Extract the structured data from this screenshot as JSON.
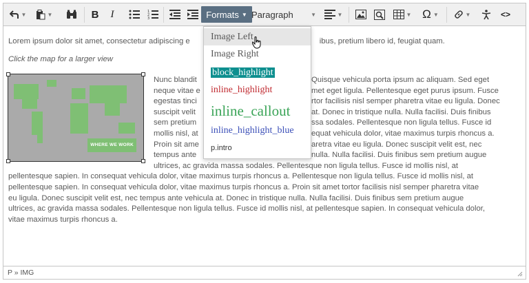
{
  "toolbar": {
    "formats_label": "Formats",
    "block_format_value": "Paragraph",
    "icons": [
      "undo-icon",
      "paste-icon",
      "find-icon",
      "bold-icon",
      "italic-icon",
      "bullet-list-icon",
      "numbered-list-icon",
      "outdent-icon",
      "indent-icon",
      "formats-dropdown",
      "align-icon",
      "image-icon",
      "media-icon",
      "table-icon",
      "special-char-icon",
      "link-icon",
      "accessibility-icon",
      "code-icon"
    ],
    "bold_glyph": "B",
    "italic_glyph": "I",
    "omega_glyph": "Ω",
    "code_glyph": "<>"
  },
  "content": {
    "paragraph1": "Lorem ipsum dolor sit amet, consectetur adipiscing e",
    "paragraph1_tail": "ibus, pretium libero id, feugiat quam.",
    "caption": "Click the map for a larger view",
    "map_tag": "WHERE WE WORK",
    "wrap_lines": [
      {
        "left": "Nunc blandit",
        "right": "Quisque vehicula porta ipsum ac aliquam. Sed eget"
      },
      {
        "left": "neque vitae e",
        "right": "met eget ligula. Pellentesque eget purus ipsum. Fusce"
      },
      {
        "left": "egestas tinci",
        "right": "rtor facilisis nisl semper pharetra vitae eu ligula. Donec"
      },
      {
        "left": "suscipit velit",
        "right": "at. Donec in tristique nulla. Nulla facilisi. Duis finibus"
      },
      {
        "left": "sem pretium",
        "right": "ssa sodales. Pellentesque non ligula tellus. Fusce id"
      },
      {
        "left": "mollis nisl, at",
        "right": "equat vehicula dolor, vitae maximus turpis rhoncus a."
      },
      {
        "left": "Proin sit ame",
        "right": "aretra vitae eu ligula. Donec suscipit velit est, nec"
      },
      {
        "left": "tempus ante",
        "right": "nulla. Nulla facilisi. Duis finibus sem pretium augue"
      }
    ],
    "after_image": "ultrices, ac gravida massa sodales. Pellentesque non ligula tellus. Fusce id mollis nisl, at",
    "full_lines": [
      "pellentesque sapien. In consequat vehicula dolor, vitae maximus turpis rhoncus a. Pellentesque non ligula tellus. Fusce id mollis nisl, at",
      "pellentesque sapien. In consequat vehicula dolor, vitae maximus turpis rhoncus a.  Proin sit amet tortor facilisis nisl semper pharetra vitae",
      "eu ligula. Donec suscipit velit est, nec tempus ante vehicula at. Donec in tristique nulla. Nulla facilisi. Duis finibus sem pretium augue",
      "ultrices, ac gravida massa sodales. Pellentesque non ligula tellus. Fusce id mollis nisl, at pellentesque sapien. In consequat vehicula dolor,",
      "vitae maximus turpis rhoncus a."
    ]
  },
  "dropdown": {
    "items": [
      {
        "label": "Image Left",
        "style": "plain",
        "color": "#595959"
      },
      {
        "label": "Image Right",
        "style": "plain",
        "color": "#595959"
      },
      {
        "label": "block_highlight",
        "style": "block",
        "color": "#ffffff",
        "background": "#0e8f8f"
      },
      {
        "label": "inline_highlight",
        "style": "inline",
        "color": "#c0292f"
      },
      {
        "label": "inline_callout",
        "style": "callout",
        "color": "#3aa457"
      },
      {
        "label": "inline_highlight_blue",
        "style": "blue",
        "color": "#3b4fb8"
      },
      {
        "label": "p.intro",
        "style": "intro",
        "color": "#333333"
      }
    ]
  },
  "statusbar": {
    "path": "P » IMG"
  }
}
